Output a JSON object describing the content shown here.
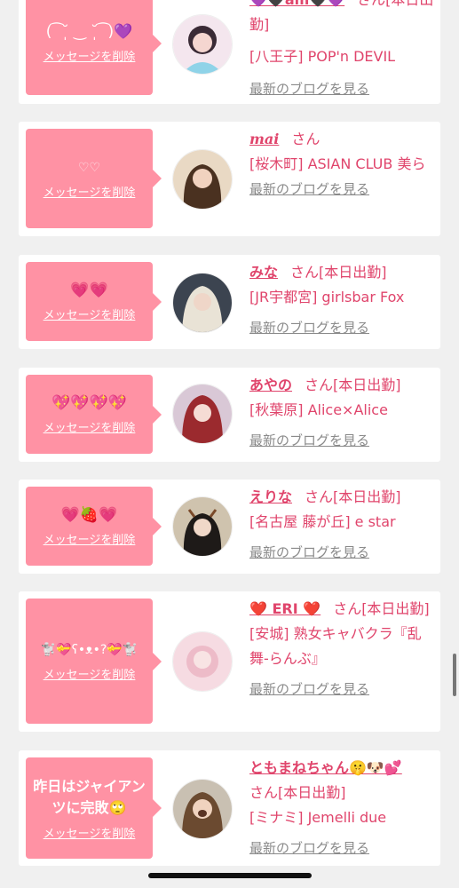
{
  "entries": [
    {
      "message": "( ͡ ˘̩ ‿ ˘̩ ͡ )💜",
      "delete_label": "メッセージを削除",
      "name": "💜🖤am🖤💜",
      "suffix": "さん[本日出勤]",
      "shop": "[八王子] POP'n DEVIL",
      "blog_label": "最新のブログを見る"
    },
    {
      "message": "♡♡",
      "delete_label": "メッセージを削除",
      "name": "mai",
      "suffix": "さん",
      "shop": "[桜木町] ASIAN CLUB 美ら",
      "blog_label": "最新のブログを見る"
    },
    {
      "message": "💗💗",
      "delete_label": "メッセージを削除",
      "name": "みな",
      "suffix": "さん[本日出勤]",
      "shop": "[JR宇都宮] girlsbar Fox",
      "blog_label": "最新のブログを見る"
    },
    {
      "message": "💖💖💖💖",
      "delete_label": "メッセージを削除",
      "name": "あやの",
      "suffix": "さん[本日出勤]",
      "shop": "[秋葉原] Alice×Alice",
      "blog_label": "最新のブログを見る"
    },
    {
      "message": "💗🍓💗",
      "delete_label": "メッセージを削除",
      "name": "えりな",
      "suffix": "さん[本日出勤]",
      "shop": "[名古屋 藤が丘] e star",
      "blog_label": "最新のブログを見る"
    },
    {
      "message": "🐩💝ʕ•ᴥ•?💝🐩",
      "delete_label": "メッセージを削除",
      "name": "❤️ ERI ❤️",
      "suffix": "さん[本日出勤]",
      "shop": "[安城] 熟女キャバクラ『乱舞-らんぶ』",
      "blog_label": "最新のブログを見る"
    },
    {
      "message": "昨日はジャイアンツに完敗🙄",
      "delete_label": "メッセージを削除",
      "name": "ともまねちゃん🤫🐶💕",
      "suffix": "さん[本日出勤]",
      "shop": "[ミナミ] Jemelli due",
      "blog_label": "最新のブログを見る"
    }
  ],
  "colors": {
    "bubble": "#ff92a4",
    "accent_text": "#e0456c",
    "muted_text": "#8a8a8a",
    "background": "#f0f0f0"
  }
}
